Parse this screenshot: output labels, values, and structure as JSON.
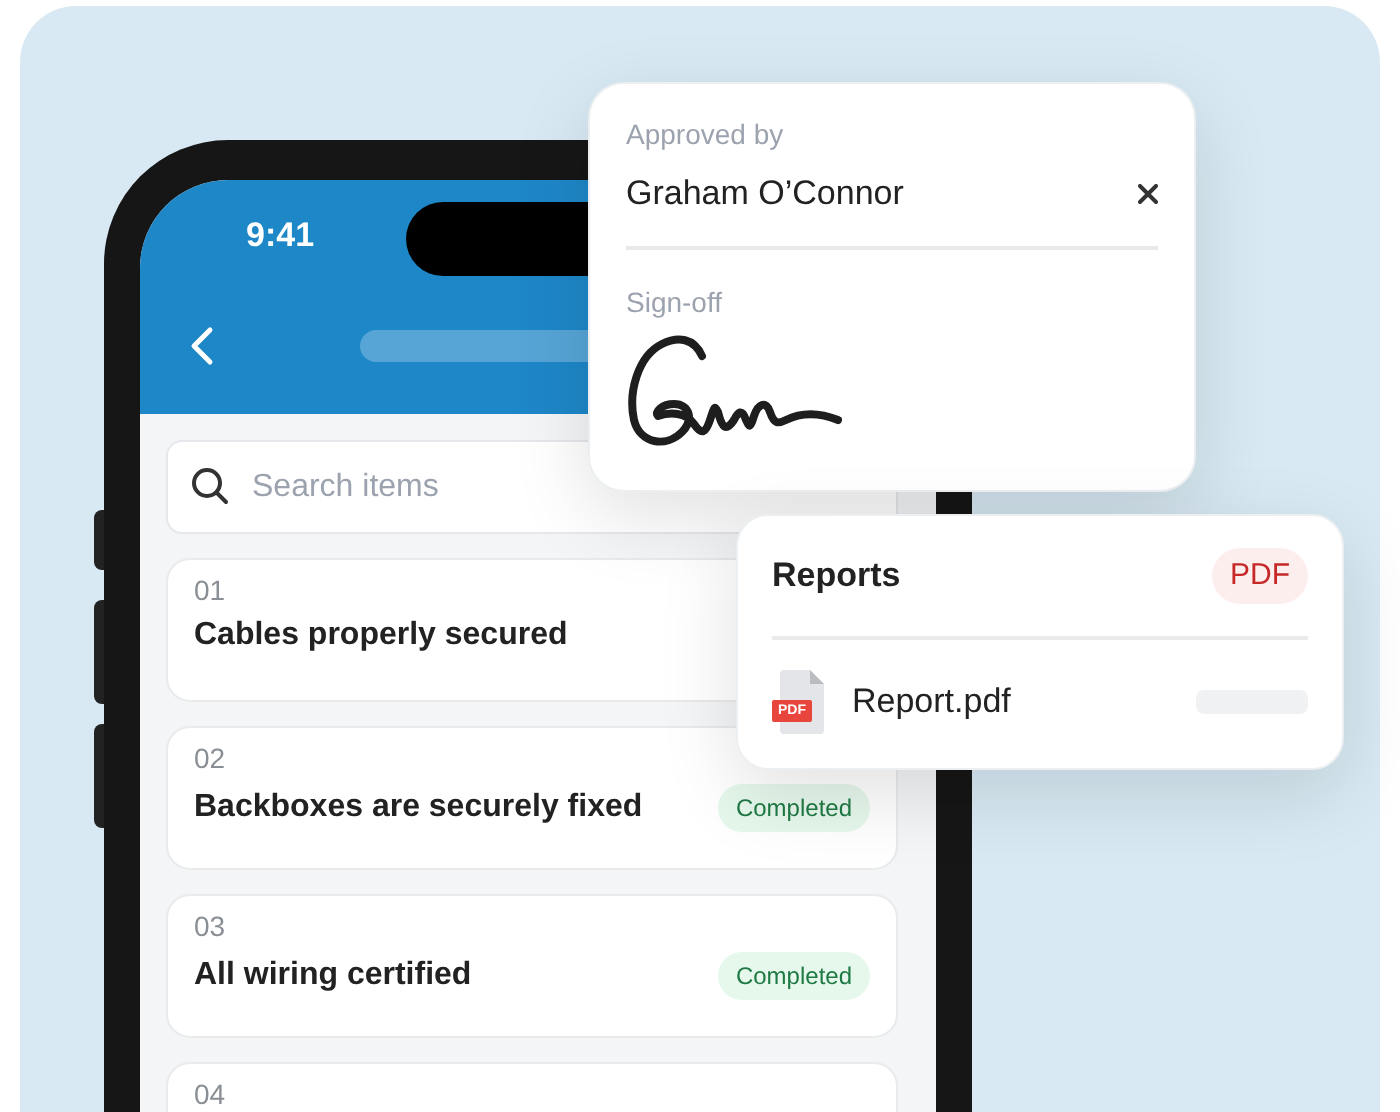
{
  "status_bar": {
    "time": "9:41"
  },
  "search": {
    "placeholder": "Search items"
  },
  "items": [
    {
      "number": "01",
      "title": "Cables properly secured"
    },
    {
      "number": "02",
      "title": "Backboxes are securely fixed",
      "status": {
        "kind": "completed",
        "label": "Completed"
      }
    },
    {
      "number": "03",
      "title": "All wiring certified",
      "status": {
        "kind": "completed",
        "label": "Completed"
      }
    },
    {
      "number": "04"
    }
  ],
  "approval": {
    "label": "Approved by",
    "value": "Graham O’Connor",
    "signoff_label": "Sign-off"
  },
  "reports": {
    "title": "Reports",
    "badge": "PDF",
    "files": [
      {
        "name": "Report.pdf",
        "icon_label": "PDF"
      }
    ]
  }
}
